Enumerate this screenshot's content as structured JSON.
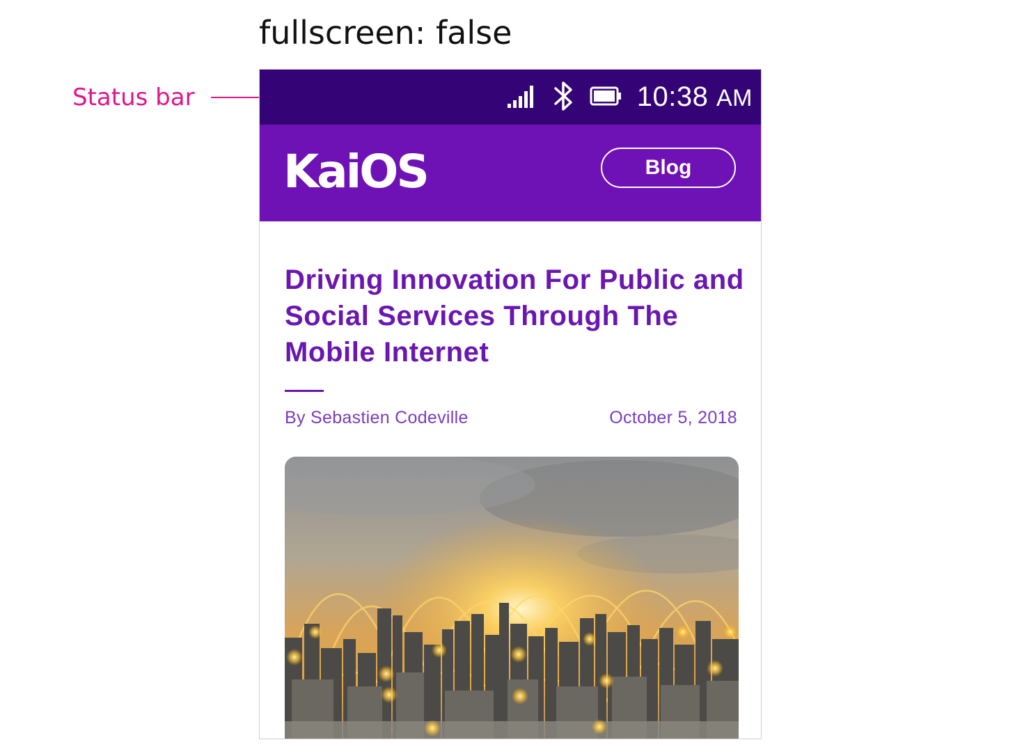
{
  "caption": "fullscreen: false",
  "annotation": {
    "label": "Status bar",
    "color": "#e0158a"
  },
  "statusbar": {
    "time": "10:38",
    "ampm": "AM",
    "icons": [
      "signal-icon",
      "bluetooth-icon",
      "battery-icon"
    ],
    "background": "#340476"
  },
  "header": {
    "logo_text": "KaiOS",
    "blog_button": "Blog",
    "background": "#6f12b5"
  },
  "article": {
    "title": "Driving Innovation For Public and Social Services Through The Mobile Internet",
    "author": "By Sebastien Codeville",
    "date": "October 5, 2018",
    "title_color": "#6a16b0",
    "image": "city-skyline-sunset-network-image"
  }
}
